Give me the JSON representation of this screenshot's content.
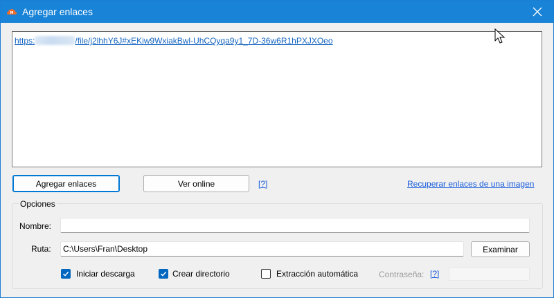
{
  "window": {
    "title": "Agregar enlaces"
  },
  "links_area": {
    "link_prefix": "https:",
    "link_suffix": "/file/j2lhhY6J#xEKiw9WxiakBwl-UhCQyqa9y1_7D-36w6R1hPXJXOeo"
  },
  "actions": {
    "add_links_label": "Agregar enlaces",
    "view_online_label": "Ver online",
    "help_label": "[?]",
    "recover_links_label": "Recuperar enlaces de una imagen"
  },
  "options": {
    "legend": "Opciones",
    "name_label": "Nombre:",
    "name_value": "",
    "path_label": "Ruta:",
    "path_value": "C:\\Users\\Fran\\Desktop",
    "browse_label": "Examinar",
    "start_download": {
      "label": "Iniciar descarga",
      "checked": true
    },
    "create_directory": {
      "label": "Crear directorio",
      "checked": true
    },
    "auto_extract": {
      "label": "Extracción automática",
      "checked": false
    },
    "password_label": "Contraseña:",
    "password_help": "[?]",
    "password_value": ""
  },
  "colors": {
    "titlebar": "#1883d7",
    "accent": "#0067c0",
    "link": "#1a5edc"
  },
  "icons": {
    "app": "cloud-icon",
    "close": "close-icon",
    "check": "checkmark-icon",
    "cursor": "mouse-cursor-icon"
  }
}
